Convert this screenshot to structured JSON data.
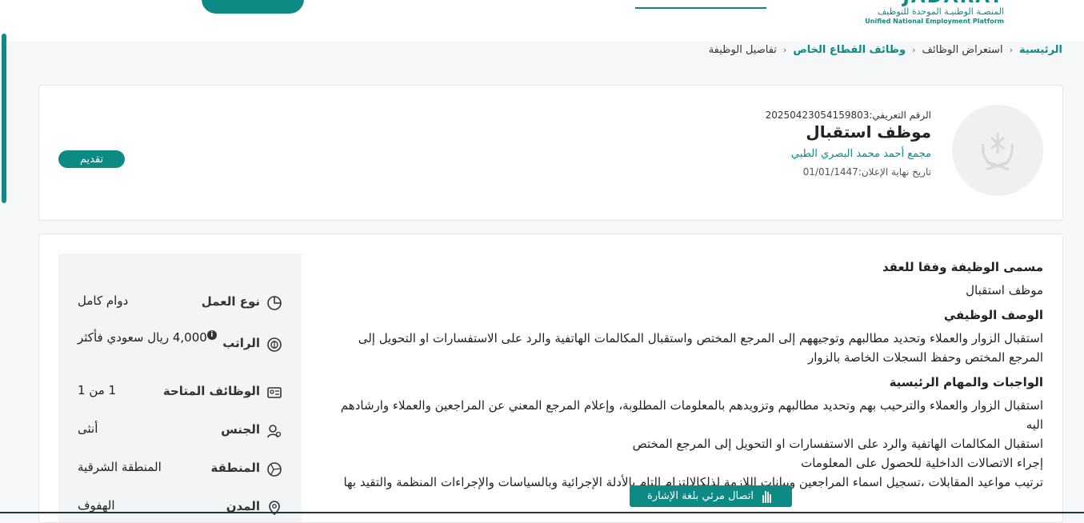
{
  "logo": {
    "en": "JADARAT",
    "ar": "المنصـة الوطنيـة الموحدة للتوظيف",
    "sub": "Unified National Employment Platform"
  },
  "breadcrumb": [
    "الرئيسية",
    "استعراض الوظائف",
    "وظائف القطاع الخاص",
    "تفاصيل الوظيفة"
  ],
  "job": {
    "id_label": "الرقم التعريفي:",
    "id": "20250423054159803",
    "title": "موظف استقبال",
    "company": "مجمع أحمد محمد البصري الطبي",
    "deadline_label": "تاريخ نهاية الإعلان:",
    "deadline": "01/01/1447",
    "apply_label": "تقديم"
  },
  "description": [
    {
      "title": "مسمى الوظيفة وفقا للعقد",
      "lines": [
        "موظف استقبال"
      ]
    },
    {
      "title": "الوصف الوظيفي",
      "lines": [
        "استقبال الزوار والعملاء وتحديد مطالبهم وتوجيههم إلى المرجع المختص واستقبال المكالمات الهاتفية والرد على الاستفسارات او التحويل إلى المرجع المختص وحفظ السجلات الخاصة بالزوار"
      ]
    },
    {
      "title": "الواجبات والمهام الرئيسية",
      "lines": [
        "استقبال الزوار والعملاء والترحيب بهم وتحديد مطالبهم وتزويدهم بالمعلومات المطلوبة، وإعلام المرجع المعني عن المراجعين والعملاء وارشادهم اليه",
        "استقبال المكالمات الهاتفية والرد على الاستفسارات او التحويل إلى المرجع المختص",
        "إجراء الاتصالات الداخلية للحصول على المعلومات",
        "ترتيب مواعيد المقابلات ،تسجيل اسماء المراجعين وبيانات اللازمة لذلكالالتزام التام بالأدلة الإجرائية وبالسياسات والإجراءات المنظمة والتقيد بها"
      ]
    }
  ],
  "attributes": [
    {
      "icon": "pie-chart-icon",
      "label": "نوع العمل",
      "value": "دوام كامل"
    },
    {
      "icon": "salary-icon",
      "label": "الراتب",
      "value": "4,000 ريال سعودي فأكثر"
    },
    {
      "icon": "id-card-icon",
      "label": "الوظائف المتاحة",
      "value": "1 من 1"
    },
    {
      "icon": "gender-icon",
      "label": "الجنس",
      "value": "أنثى"
    },
    {
      "icon": "region-map-icon",
      "label": "المنطقة",
      "value": "المنطقة الشرقية"
    },
    {
      "icon": "location-pin-icon",
      "label": "المدن",
      "value": "الهفوف"
    }
  ],
  "sign_language_label": "اتصال مرئي بلغة الإشارة",
  "colors": {
    "primary": "#0d8a84",
    "text": "#222222",
    "panel": "#f2f4f6"
  }
}
